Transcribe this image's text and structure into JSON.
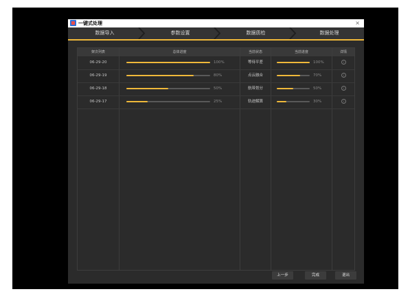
{
  "window": {
    "title": "一键式处理",
    "close_label": "×"
  },
  "steps": [
    "数据导入",
    "参数设置",
    "数据质检",
    "数据处理"
  ],
  "table": {
    "headers": [
      "架次列表",
      "总体进度",
      "当前状态",
      "当前进度",
      "详情"
    ],
    "rows": [
      {
        "sortie": "06-29-20",
        "overall": 100,
        "overall_label": "100%",
        "status": "等待平差",
        "current": 100,
        "current_label": "100%"
      },
      {
        "sortie": "06-29-19",
        "overall": 80,
        "overall_label": "80%",
        "status": "点云融合",
        "current": 70,
        "current_label": "70%"
      },
      {
        "sortie": "06-29-18",
        "overall": 50,
        "overall_label": "50%",
        "status": "航带划分",
        "current": 50,
        "current_label": "50%"
      },
      {
        "sortie": "06-29-17",
        "overall": 25,
        "overall_label": "25%",
        "status": "轨迹解算",
        "current": 30,
        "current_label": "30%"
      }
    ],
    "detail_icon": "info-circle-icon",
    "detail_glyph": "i"
  },
  "buttons": {
    "prev": "上一步",
    "finish": "完成",
    "exit": "退出"
  },
  "colors": {
    "accent": "#f0b93a",
    "window_bg": "#2b2b2b",
    "track": "#595959"
  }
}
